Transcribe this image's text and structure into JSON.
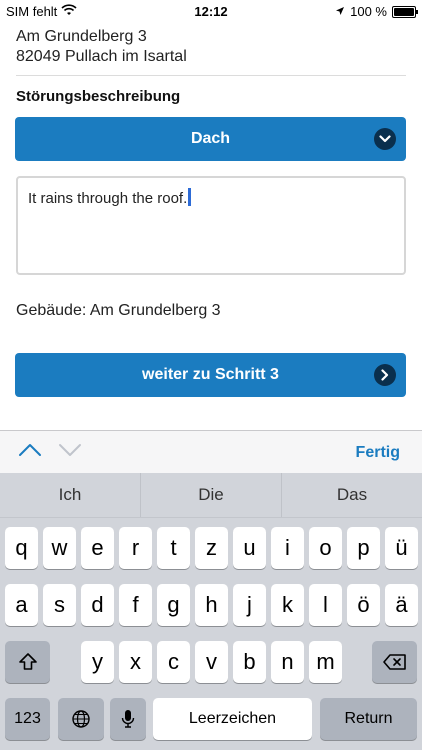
{
  "statusbar": {
    "carrier": "SIM fehlt",
    "time": "12:12",
    "battery": "100 %"
  },
  "address": {
    "line1": "Am Grundelberg 3",
    "line2": "82049 Pullach im Isartal"
  },
  "form": {
    "section_title": "Störungsbeschreibung",
    "dropdown_value": "Dach",
    "description_value": "It rains through the roof.",
    "building_label": "Gebäude: Am Grundelberg 3",
    "next_button": "weiter zu Schritt 3"
  },
  "accessory": {
    "done_label": "Fertig"
  },
  "keyboard": {
    "suggestions": [
      "Ich",
      "Die",
      "Das"
    ],
    "row1": [
      "q",
      "w",
      "e",
      "r",
      "t",
      "z",
      "u",
      "i",
      "o",
      "p",
      "ü"
    ],
    "row2": [
      "a",
      "s",
      "d",
      "f",
      "g",
      "h",
      "j",
      "k",
      "l",
      "ö",
      "ä"
    ],
    "row3": [
      "y",
      "x",
      "c",
      "v",
      "b",
      "n",
      "m"
    ],
    "numbers_key": "123",
    "space_key": "Leerzeichen",
    "return_key": "Return"
  }
}
